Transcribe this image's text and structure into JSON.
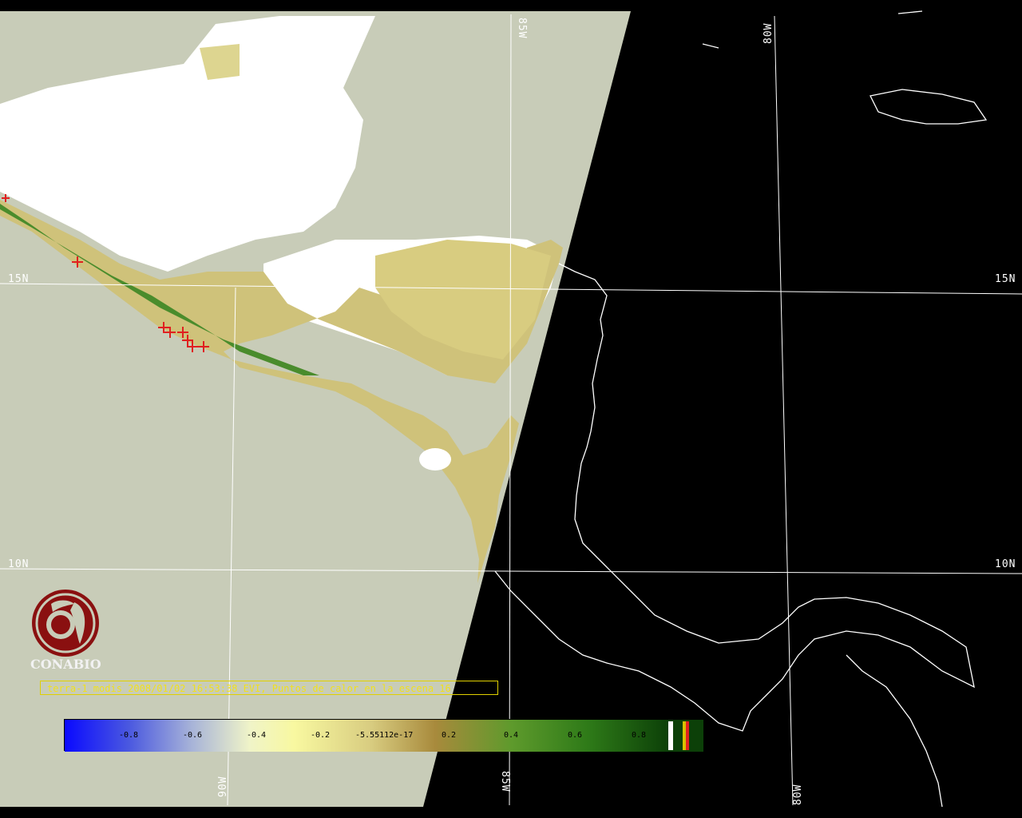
{
  "map": {
    "grid_labels": {
      "lat_15_left": "15N",
      "lat_15_right": "15N",
      "lat_10_left": "10N",
      "lat_10_right": "10N",
      "lon_85_top": "85W",
      "lon_80_top": "80W",
      "lon_90_bottom": "90W",
      "lon_85_bottom": "85W",
      "lon_80_bottom": "80W"
    },
    "colors": {
      "background": "#000000",
      "land_mask": "#ffffff",
      "ocean_swath": "#c8ccb8",
      "vegetation_low": "#e8e090",
      "vegetation_high": "#3c8a20",
      "grid": "#ffffff",
      "hotspot": "#e02020"
    }
  },
  "logo": {
    "text": "CONABIO",
    "icon": "conabio-macaw-logo-icon",
    "color": "#8a1010"
  },
  "caption": {
    "text": "terra-1 modis 2008/01/02 16:53:38 EVI, Puntos de calor en la escena 16"
  },
  "colorbar": {
    "ticks": [
      "-0.8",
      "-0.6",
      "-0.4",
      "-0.2",
      "-5.55112e-17",
      "0.2",
      "0.4",
      "0.6",
      "0.8"
    ]
  }
}
